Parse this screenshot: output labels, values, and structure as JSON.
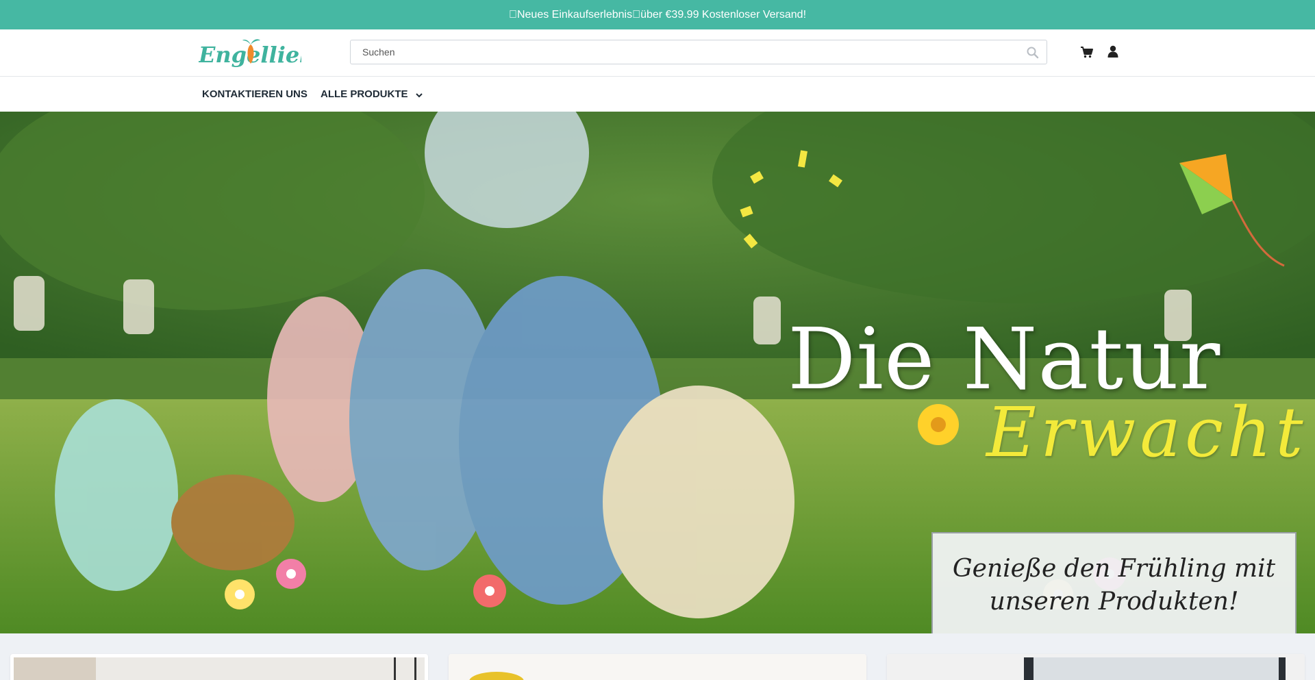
{
  "announcement": {
    "text": "\u0000Neues Einkaufserlebnis\u0000über €39.99 Kostenloser Versand!"
  },
  "header": {
    "logo_text": "Engelliebe",
    "search": {
      "placeholder": "Suchen",
      "value": ""
    },
    "icons": {
      "search": "search-icon",
      "cart": "cart-icon",
      "account": "user-icon"
    }
  },
  "nav": {
    "items": [
      {
        "label": "KONTAKTIEREN UNS"
      },
      {
        "label": "ALLE PRODUKTE",
        "icon": "chevron-down-icon"
      }
    ]
  },
  "hero": {
    "title": "Die Natur",
    "script": "Erwacht",
    "banner": "Genieße den Frühling mit unseren Produkten!"
  },
  "colors": {
    "accent": "#46b8a3",
    "logo": "#3fb39e",
    "script_yellow": "#f3ea3a"
  }
}
